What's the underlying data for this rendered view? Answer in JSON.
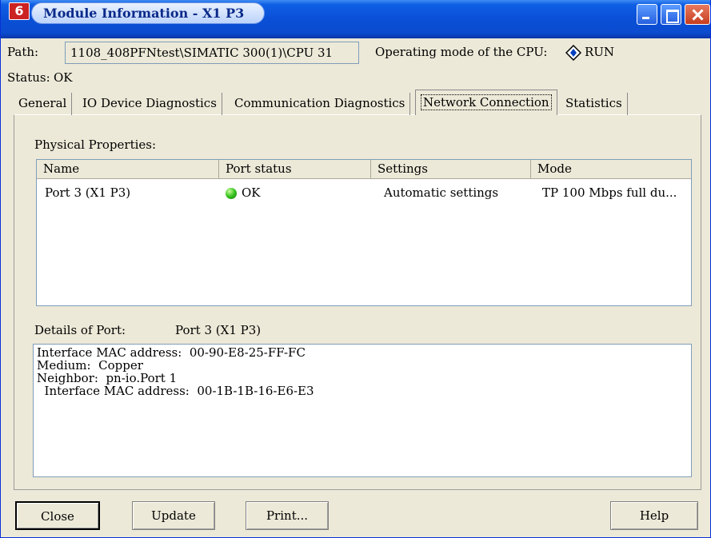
{
  "window": {
    "title": "Module Information - X1 P3",
    "icon_glyph": "6"
  },
  "header": {
    "path_label": "Path:",
    "path_value": "1108_408PFNtest\\SIMATIC 300(1)\\CPU 31",
    "op_mode_label": "Operating mode of the CPU:",
    "op_mode_value": "RUN",
    "status_label": "Status:",
    "status_value": "OK"
  },
  "tabs": [
    {
      "label": "General",
      "active": false
    },
    {
      "label": "IO Device Diagnostics",
      "active": false
    },
    {
      "label": "Communication Diagnostics",
      "active": false
    },
    {
      "label": "Network Connection",
      "active": true
    },
    {
      "label": "Statistics",
      "active": false
    }
  ],
  "physical": {
    "label": "Physical Properties:",
    "columns": [
      "Name",
      "Port status",
      "Settings",
      "Mode"
    ],
    "rows": [
      {
        "name": "Port 3 (X1 P3)",
        "status": "OK",
        "settings": "Automatic settings",
        "mode": "TP 100 Mbps full du..."
      }
    ]
  },
  "details": {
    "label": "Details of Port:",
    "port": "Port 3 (X1 P3)",
    "text": "Interface MAC address:  00-90-E8-25-FF-FC\nMedium:  Copper\nNeighbor:  pn-io.Port 1\n  Interface MAC address:  00-1B-1B-16-E6-E3"
  },
  "buttons": {
    "close": "Close",
    "update": "Update",
    "print": "Print...",
    "help": "Help"
  },
  "colors": {
    "status_ok": "#35c21e",
    "titlebar": "#0a4fd6"
  }
}
